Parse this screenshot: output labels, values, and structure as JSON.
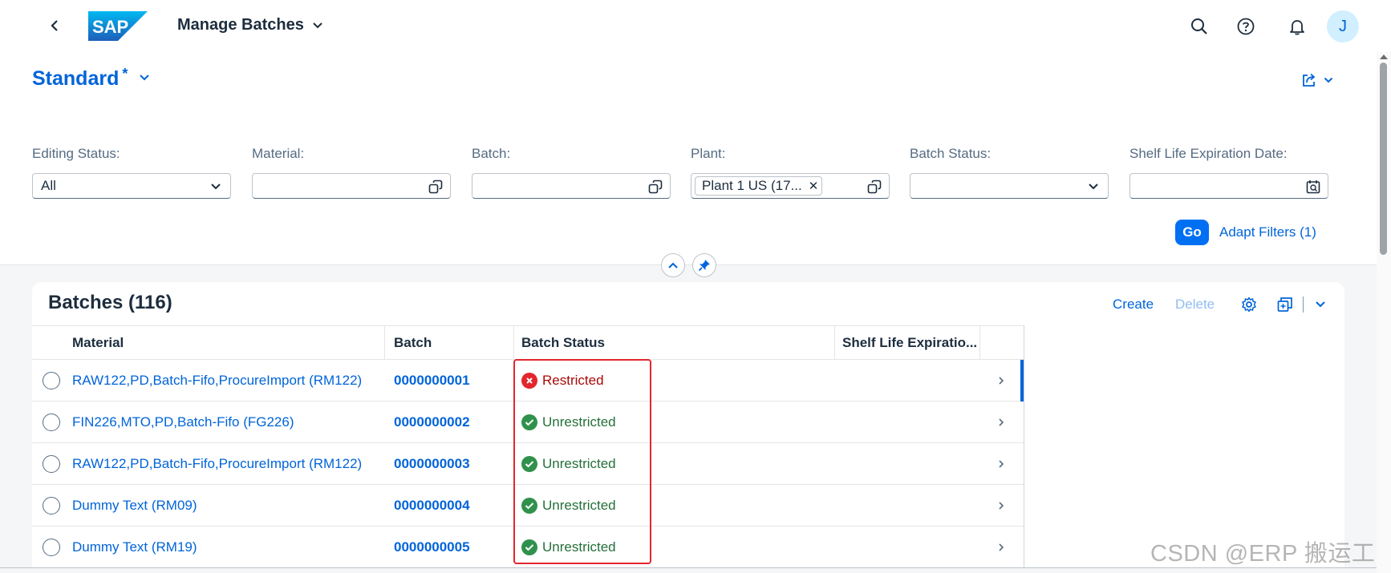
{
  "shell": {
    "logo_text": "SAP",
    "app_title": "Manage Batches",
    "avatar_initial": "J"
  },
  "header": {
    "variant_name": "Standard",
    "variant_modified_marker": "*"
  },
  "filters": [
    {
      "label": "Editing Status:",
      "value": "All",
      "control": "select"
    },
    {
      "label": "Material:",
      "value": "",
      "control": "valuehelp"
    },
    {
      "label": "Batch:",
      "value": "",
      "control": "valuehelp"
    },
    {
      "label": "Plant:",
      "value": "",
      "token": "Plant 1 US (17...",
      "control": "valuehelp"
    },
    {
      "label": "Batch Status:",
      "value": "",
      "control": "select"
    },
    {
      "label": "Shelf Life Expiration Date:",
      "value": "",
      "control": "date"
    }
  ],
  "filter_actions": {
    "go_label": "Go",
    "adapt_label": "Adapt Filters (1)"
  },
  "table": {
    "title": "Batches (116)",
    "toolbar": {
      "create_label": "Create",
      "delete_label": "Delete"
    },
    "columns": [
      "Material",
      "Batch",
      "Batch Status",
      "Shelf Life Expiratio..."
    ],
    "rows": [
      {
        "material": "RAW122,PD,Batch-Fifo,ProcureImport (RM122)",
        "batch": "0000000001",
        "status": "Restricted",
        "status_type": "error",
        "shelf_life": ""
      },
      {
        "material": "FIN226,MTO,PD,Batch-Fifo (FG226)",
        "batch": "0000000002",
        "status": "Unrestricted",
        "status_type": "success",
        "shelf_life": ""
      },
      {
        "material": "RAW122,PD,Batch-Fifo,ProcureImport (RM122)",
        "batch": "0000000003",
        "status": "Unrestricted",
        "status_type": "success",
        "shelf_life": ""
      },
      {
        "material": "Dummy Text (RM09)",
        "batch": "0000000004",
        "status": "Unrestricted",
        "status_type": "success",
        "shelf_life": ""
      },
      {
        "material": "Dummy Text (RM19)",
        "batch": "0000000005",
        "status": "Unrestricted",
        "status_type": "success",
        "shelf_life": ""
      }
    ]
  },
  "colors": {
    "brand_blue": "#0064d9",
    "button_blue": "#0070f2",
    "error": "#aa0808",
    "error_icon": "#e3262e",
    "success": "#256f3a",
    "success_icon": "#30914c",
    "annotation_box": "#e3262e"
  },
  "icons": {
    "back": "chevron-left-icon",
    "title_menu": "chevron-down-icon",
    "search": "search-icon",
    "help": "help-icon",
    "notifications": "bell-icon",
    "share": "share-icon",
    "value_help": "value-help-icon",
    "calendar": "calendar-icon",
    "collapse": "chevron-up-icon",
    "pin": "pin-icon",
    "settings": "gear-icon",
    "export": "export-icon",
    "row_nav": "chevron-right-icon",
    "status_error": "error-circle-icon",
    "status_success": "check-circle-icon"
  },
  "watermark": "CSDN @ERP 搬运工"
}
